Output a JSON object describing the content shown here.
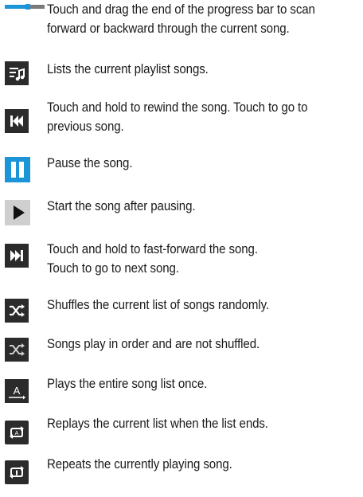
{
  "items": [
    {
      "icon": "progress-bar-icon",
      "lines": [
        "Touch and drag the end of the progress bar to scan",
        "forward or backward through the current song."
      ]
    },
    {
      "icon": "playlist-icon",
      "lines": [
        "Lists the current playlist songs."
      ]
    },
    {
      "icon": "rewind-icon",
      "lines": [
        "Touch and hold to rewind the song. Touch to go to",
        "previous song."
      ]
    },
    {
      "icon": "pause-icon",
      "lines": [
        "Pause the song."
      ]
    },
    {
      "icon": "play-icon",
      "lines": [
        "Start the song after pausing."
      ]
    },
    {
      "icon": "fast-forward-icon",
      "lines": [
        "Touch and hold to fast-forward the song.",
        "Touch to go to next song."
      ]
    },
    {
      "icon": "shuffle-on-icon",
      "lines": [
        "Shuffles the current list of songs randomly."
      ]
    },
    {
      "icon": "shuffle-off-icon",
      "lines": [
        "Songs play in order and are not shuffled."
      ]
    },
    {
      "icon": "play-all-once-icon",
      "lines": [
        "Plays the entire song list once."
      ]
    },
    {
      "icon": "repeat-all-icon",
      "lines": [
        "Replays the current list when the list ends."
      ]
    },
    {
      "icon": "repeat-one-icon",
      "lines": [
        "Repeats the currently playing song."
      ]
    }
  ],
  "colors": {
    "dark_tile": "#2b2b2b",
    "blue_tile": "#1c95d8",
    "light_tile": "#cfcfcf",
    "progress_track": "#7a7a7a",
    "progress_fill": "#1c95d8",
    "text": "#1a1a1a"
  }
}
